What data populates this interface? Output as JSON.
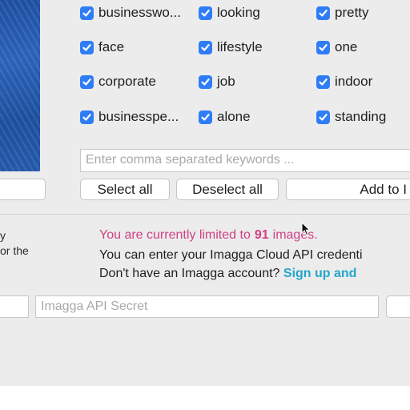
{
  "keywords": [
    {
      "label": "businesswo...",
      "checked": true
    },
    {
      "label": "looking",
      "checked": true
    },
    {
      "label": "pretty",
      "checked": true
    },
    {
      "label": "face",
      "checked": true
    },
    {
      "label": "lifestyle",
      "checked": true
    },
    {
      "label": "one",
      "checked": true
    },
    {
      "label": "corporate",
      "checked": true
    },
    {
      "label": "job",
      "checked": true
    },
    {
      "label": "indoor",
      "checked": true
    },
    {
      "label": "businesspe...",
      "checked": true
    },
    {
      "label": "alone",
      "checked": true
    },
    {
      "label": "standing",
      "checked": true
    }
  ],
  "keyword_input": {
    "placeholder": "Enter comma separated keywords ...",
    "value": ""
  },
  "buttons": {
    "select_all": "Select all",
    "deselect_all": "Deselect all",
    "add_to": "Add to I"
  },
  "sidebar_text": {
    "line1": "y",
    "line2": "or the"
  },
  "info": {
    "limited_prefix": "You are currently limited to",
    "limited_count": "91",
    "limited_suffix": "images.",
    "credentials_line": "You can enter your Imagga Cloud API credenti",
    "account_question": "Don't have an Imagga account?",
    "signup_link": "Sign up and"
  },
  "api_secret": {
    "placeholder": "Imagga API Secret",
    "value": ""
  },
  "colors": {
    "checkbox_blue": "#2f7df6",
    "limit_pink": "#d03f86",
    "link_teal": "#22a6c9"
  }
}
